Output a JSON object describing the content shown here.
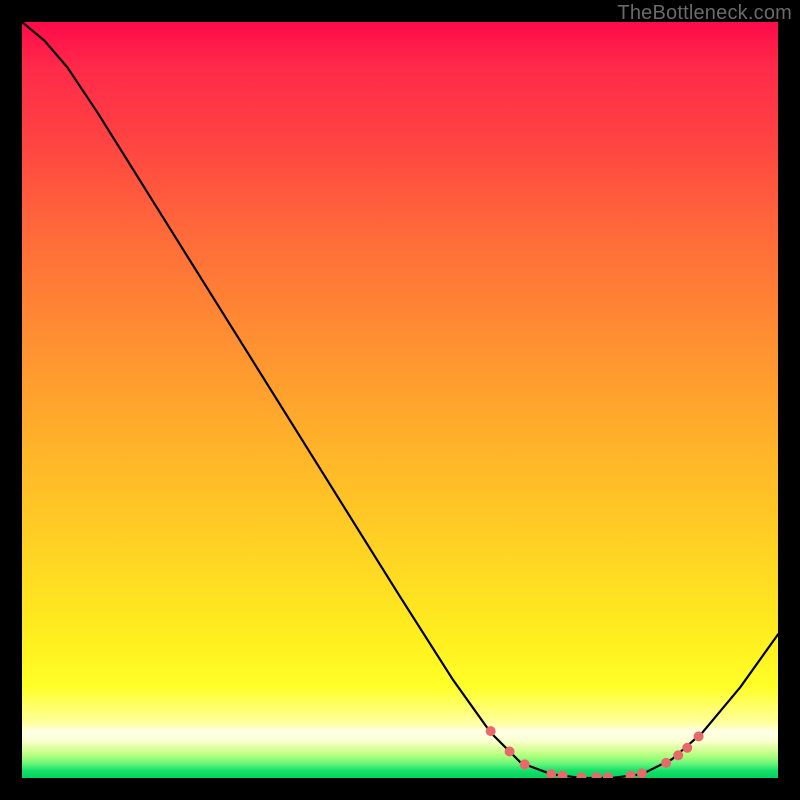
{
  "watermark": "TheBottleneck.com",
  "chart_data": {
    "type": "line",
    "title": "",
    "xlabel": "",
    "ylabel": "",
    "xlim": [
      0,
      1
    ],
    "ylim": [
      0,
      1
    ],
    "series": [
      {
        "name": "curve",
        "points": [
          {
            "x": 0.0,
            "y": 1.0
          },
          {
            "x": 0.03,
            "y": 0.975
          },
          {
            "x": 0.06,
            "y": 0.94
          },
          {
            "x": 0.1,
            "y": 0.88
          },
          {
            "x": 0.15,
            "y": 0.8
          },
          {
            "x": 0.2,
            "y": 0.72
          },
          {
            "x": 0.3,
            "y": 0.56
          },
          {
            "x": 0.4,
            "y": 0.4
          },
          {
            "x": 0.5,
            "y": 0.24
          },
          {
            "x": 0.57,
            "y": 0.13
          },
          {
            "x": 0.62,
            "y": 0.06
          },
          {
            "x": 0.66,
            "y": 0.02
          },
          {
            "x": 0.7,
            "y": 0.005
          },
          {
            "x": 0.74,
            "y": 0.0
          },
          {
            "x": 0.78,
            "y": 0.0
          },
          {
            "x": 0.82,
            "y": 0.005
          },
          {
            "x": 0.86,
            "y": 0.025
          },
          {
            "x": 0.9,
            "y": 0.06
          },
          {
            "x": 0.95,
            "y": 0.12
          },
          {
            "x": 1.0,
            "y": 0.19
          }
        ]
      }
    ],
    "markers": [
      {
        "x": 0.62,
        "y": 0.062
      },
      {
        "x": 0.645,
        "y": 0.035
      },
      {
        "x": 0.665,
        "y": 0.018
      },
      {
        "x": 0.7,
        "y": 0.005
      },
      {
        "x": 0.715,
        "y": 0.003
      },
      {
        "x": 0.74,
        "y": 0.001
      },
      {
        "x": 0.76,
        "y": 0.001
      },
      {
        "x": 0.775,
        "y": 0.001
      },
      {
        "x": 0.805,
        "y": 0.003
      },
      {
        "x": 0.82,
        "y": 0.006
      },
      {
        "x": 0.852,
        "y": 0.02
      },
      {
        "x": 0.868,
        "y": 0.03
      },
      {
        "x": 0.88,
        "y": 0.04
      },
      {
        "x": 0.895,
        "y": 0.055
      }
    ],
    "gradient_palette": {
      "top": "#ff0a4a",
      "mid_upper": "#ff8a33",
      "mid": "#ffd324",
      "lower": "#ffff28",
      "bottom": "#00d35d"
    },
    "curve_color": "#000000",
    "marker_color": "#e66a6a"
  }
}
